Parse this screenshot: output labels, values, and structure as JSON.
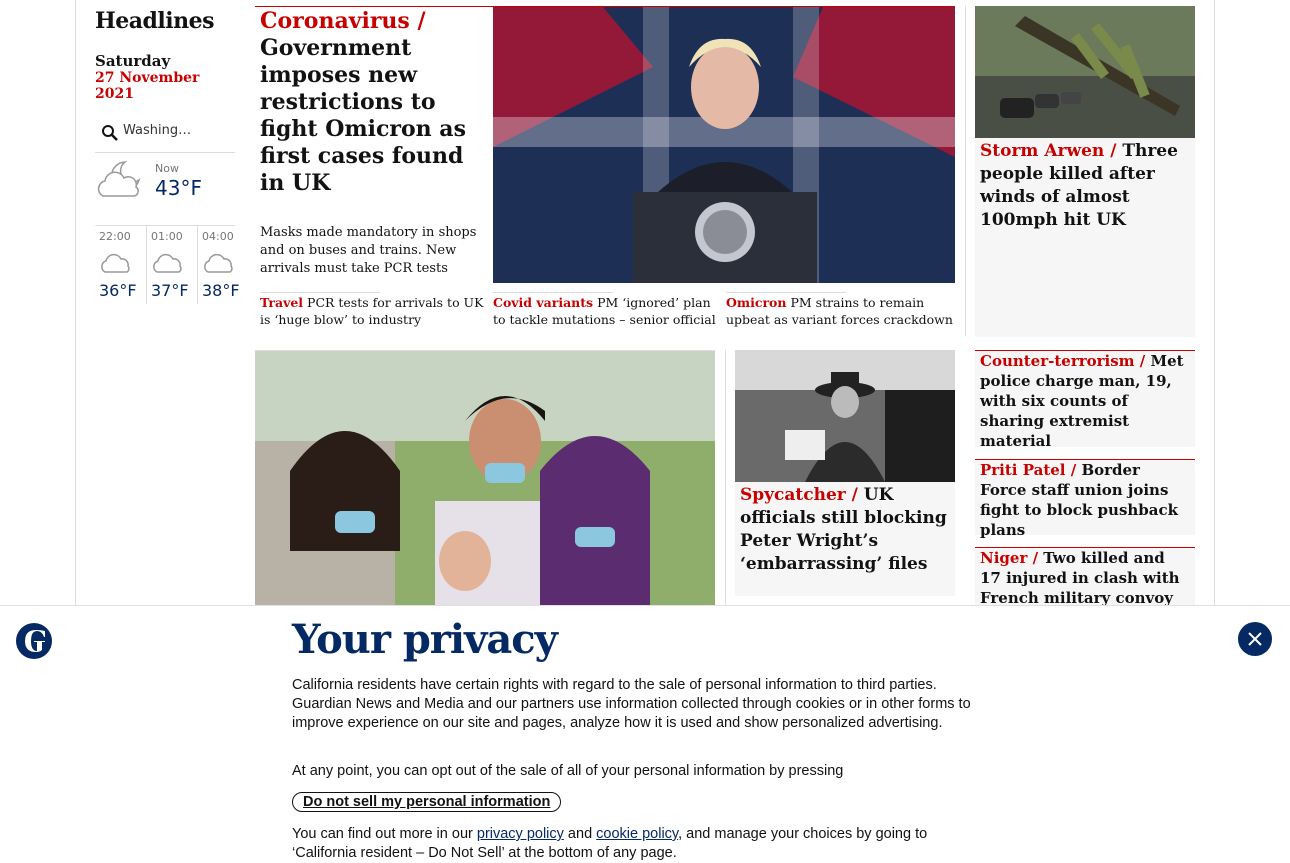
{
  "left": {
    "title": "Headlines",
    "day": "Saturday",
    "date": "27 November 2021",
    "search_text": "Washing…",
    "now_label": "Now",
    "now_temp": "43°F",
    "forecast": [
      {
        "time": "22:00",
        "temp": "36°F"
      },
      {
        "time": "01:00",
        "temp": "37°F"
      },
      {
        "time": "04:00",
        "temp": "38°F"
      }
    ]
  },
  "lead": {
    "kicker": "Coronavirus /",
    "headline": "Government imposes new restrictions to fight Omicron as first cases found in UK",
    "standfirst": "Masks made mandatory in shops and on buses and trains. New arrivals must take PCR tests",
    "subs": [
      {
        "kicker": "Travel",
        "text": "PCR tests for arrivals to UK is ‘huge blow’ to industry"
      },
      {
        "kicker": "Covid variants",
        "text": "PM ‘ignored’ plan to tackle mutations – senior official"
      },
      {
        "kicker": "Omicron",
        "text": "PM strains to remain upbeat as variant forces crackdown"
      }
    ]
  },
  "storm": {
    "kicker": "Storm Arwen /",
    "text": "Three people killed after winds of almost 100mph hit UK"
  },
  "spycatcher": {
    "kicker": "Spycatcher /",
    "text": "UK officials still blocking Peter Wright’s ‘embarrassing’ files"
  },
  "right_list": [
    {
      "kicker": "Counter-terrorism /",
      "text": "Met police charge man, 19, with six counts of sharing extremist material"
    },
    {
      "kicker": "Priti Patel /",
      "text": "Border Force staff union joins fight to block pushback plans"
    },
    {
      "kicker": "Niger /",
      "text": "Two killed and 17 injured in clash with French military convoy"
    }
  ],
  "privacy": {
    "title": "Your privacy",
    "p1": "California residents have certain rights with regard to the sale of personal information to third parties. Guardian News and Media and our partners use information collected through cookies or in other forms to improve experience on our site and pages, analyze how it is used and show personalized advertising.",
    "p2": "At any point, you can opt out of the sale of all of your personal information by pressing",
    "button": "Do not sell my personal information",
    "p3_a": "You can find out more in our ",
    "privacy_link": "privacy policy",
    "p3_b": " and ",
    "cookie_link": "cookie policy",
    "p3_c": ", and manage your choices by going to ‘California resident – Do Not Sell’ at the bottom of any page."
  },
  "colors": {
    "accent": "#c70000",
    "brand": "#052962",
    "card": "#f6f6f6"
  }
}
